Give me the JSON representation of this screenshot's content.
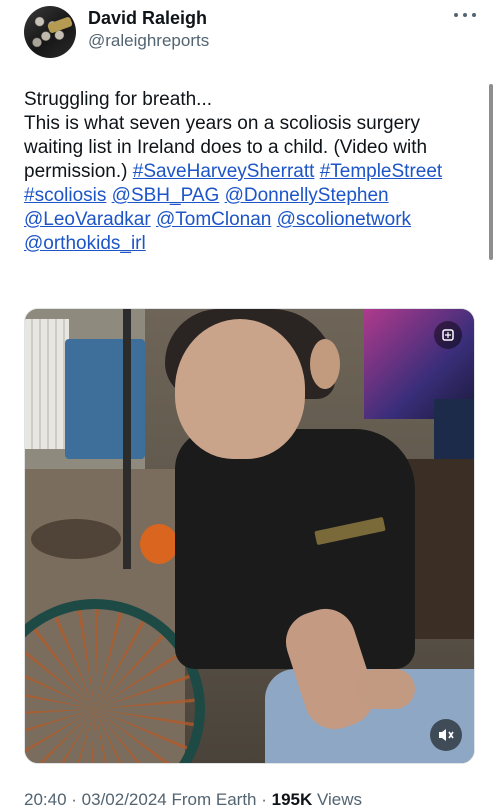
{
  "author": {
    "display_name": "David Raleigh",
    "handle": "@raleighreports"
  },
  "tweet": {
    "lines": [
      "Struggling for breath...",
      "This is what seven years on a scoliosis surgery waiting list in Ireland does to a child. (Video with permission.) "
    ],
    "links": [
      "#SaveHarveySherratt",
      "#TempleStreet",
      "#scoliosis",
      "@SBH_PAG",
      "@DonnellyStephen",
      "@LeoVaradkar",
      "@TomClonan",
      "@scolionetwork",
      "@orthokids_irl"
    ]
  },
  "media": {
    "badge_icon": "sensitive-media-icon",
    "mute_icon": "speaker-muted-icon"
  },
  "meta": {
    "time": "20:40",
    "date": "03/02/2024",
    "source": "From Earth",
    "views_count": "195K",
    "views_label": "Views"
  },
  "colors": {
    "link": "#1d55c8",
    "text": "#0f1419",
    "muted": "#536471"
  }
}
